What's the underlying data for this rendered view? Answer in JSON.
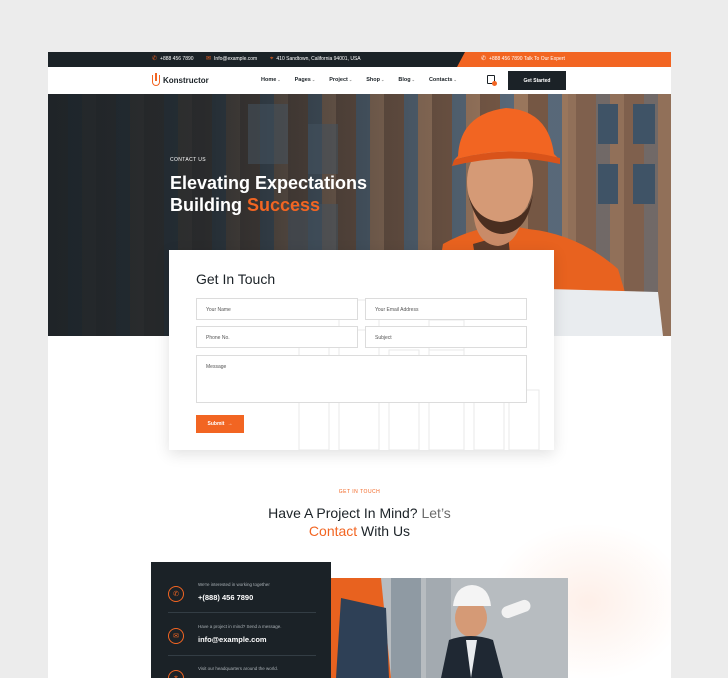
{
  "topbar": {
    "phone": "+888 456 7890",
    "email": "Info@example.com",
    "address": "410 Sandtown, California 94001, USA",
    "expert": "+888 456 7890  Talk To Our Expert"
  },
  "nav": {
    "logo": "Konstructor",
    "menu": [
      {
        "label": "Home",
        "chevron": "⌄"
      },
      {
        "label": "Pages",
        "chevron": "⌄"
      },
      {
        "label": "Project",
        "chevron": "⌄"
      },
      {
        "label": "Shop",
        "chevron": "⌄"
      },
      {
        "label": "Blog",
        "chevron": "⌄"
      },
      {
        "label": "Contacts",
        "chevron": "⌄"
      }
    ],
    "cta": "Get Started"
  },
  "hero": {
    "subtitle": "CONTACT US",
    "title_line1": "Elevating Expectations",
    "title_line2_prefix": "Building ",
    "title_line2_accent": "Success"
  },
  "form": {
    "title": "Get In Touch",
    "name_placeholder": "Your Name",
    "email_placeholder": "Your Email Address",
    "phone_placeholder": "Phone No.",
    "subject_placeholder": "Subject",
    "message_placeholder": "Message",
    "submit_label": "Submit",
    "submit_arrow": "→"
  },
  "contact_section": {
    "subtitle": "GET IN TOUCH",
    "title_line1_a": "Have A Project In Mind?",
    "title_line1_b": " Let’s",
    "title_line2_accent": "Contact",
    "title_line2_rest": " With Us"
  },
  "info": {
    "items": [
      {
        "label": "We're interested in working together",
        "value": "+(888) 456 7890",
        "icon": "phone-icon"
      },
      {
        "label": "Have a project in mind? Send a message.",
        "value": "info@example.com",
        "icon": "mail-icon"
      },
      {
        "label": "Visit our headquarters around the world.",
        "value": "",
        "icon": "location-icon"
      }
    ]
  },
  "colors": {
    "accent": "#f26522",
    "dark": "#1b2227"
  }
}
